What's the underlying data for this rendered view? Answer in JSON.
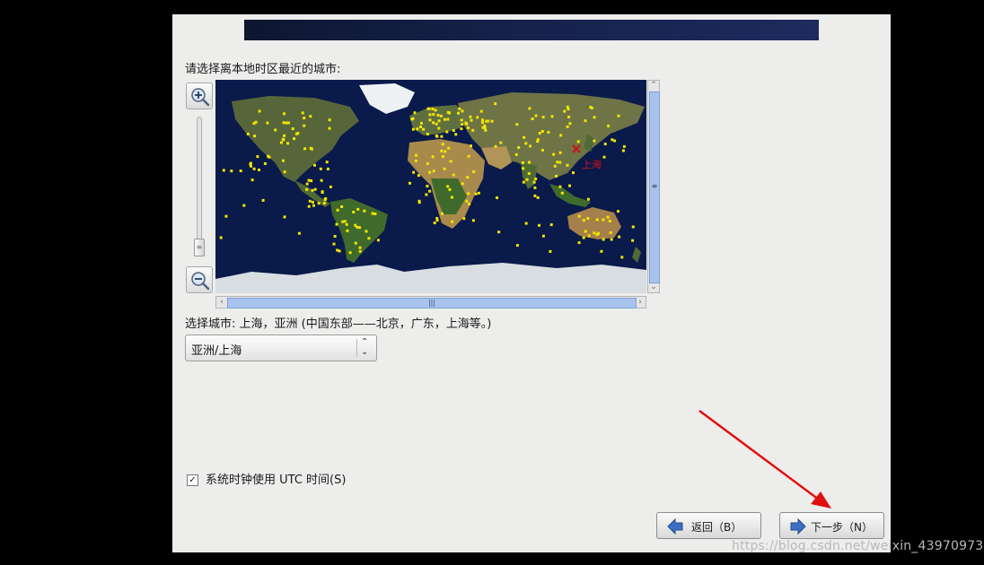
{
  "page": {
    "prompt": "请选择离本地时区最近的城市:",
    "selected_city_text": "选择城市: 上海，亚洲 (中国东部——北京，广东，上海等。)",
    "timezone_value": "亚洲/上海",
    "utc_checkbox_label": "系统时钟使用 UTC 时间(S)",
    "utc_checked": true,
    "check_mark": "✓"
  },
  "map": {
    "marker_label": "上海",
    "marker_color": "#d0101a",
    "city_dot_color": "#f2e600",
    "ocean_color": "#0a1a4a"
  },
  "zoom": {
    "zoom_in_icon": "zoom-in-icon",
    "zoom_out_icon": "zoom-out-icon"
  },
  "buttons": {
    "back_label": "返回（B）",
    "next_label": "下一步（N）"
  },
  "scrollbar_glyphs": {
    "up": "⌃",
    "down": "⌄",
    "left": "‹",
    "right": "›",
    "grip_v": "≡",
    "grip_h": "|||"
  },
  "combo_arrows": {
    "up": "⌃",
    "down": "⌄"
  },
  "watermark": "https://blog.csdn.net/weixin_43970973"
}
